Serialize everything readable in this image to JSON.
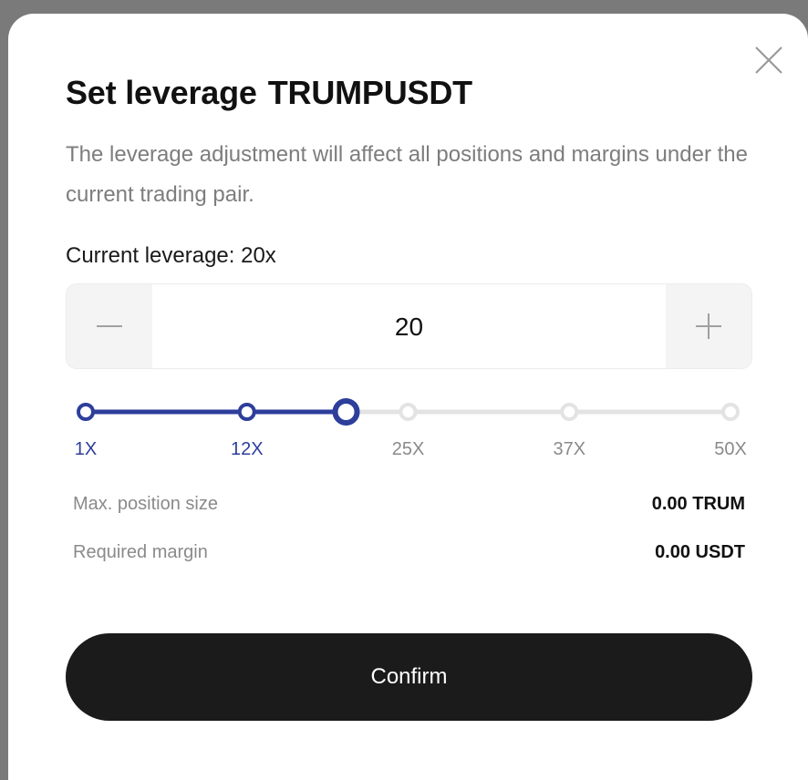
{
  "dialog": {
    "title": "Set leverage",
    "pair": "TRUMPUSDT",
    "description": "The leverage adjustment will affect all positions and margins under the current trading pair.",
    "current_leverage_text": "Current leverage: 20x",
    "close_icon": "close-icon"
  },
  "stepper": {
    "value": "20",
    "minus_icon": "minus-icon",
    "plus_icon": "plus-icon"
  },
  "slider": {
    "min": 1,
    "max": 50,
    "value": 20,
    "accent_color": "#2d3e9b",
    "track_color": "#e3e3e3",
    "ticks": [
      {
        "label": "1X",
        "value": 1
      },
      {
        "label": "12X",
        "value": 12
      },
      {
        "label": "25X",
        "value": 25
      },
      {
        "label": "37X",
        "value": 37
      },
      {
        "label": "50X",
        "value": 50
      }
    ]
  },
  "info": {
    "max_position_label": "Max. position size",
    "max_position_value": "0.00 TRUM",
    "required_margin_label": "Required margin",
    "required_margin_value": "0.00 USDT"
  },
  "actions": {
    "confirm_label": "Confirm"
  }
}
